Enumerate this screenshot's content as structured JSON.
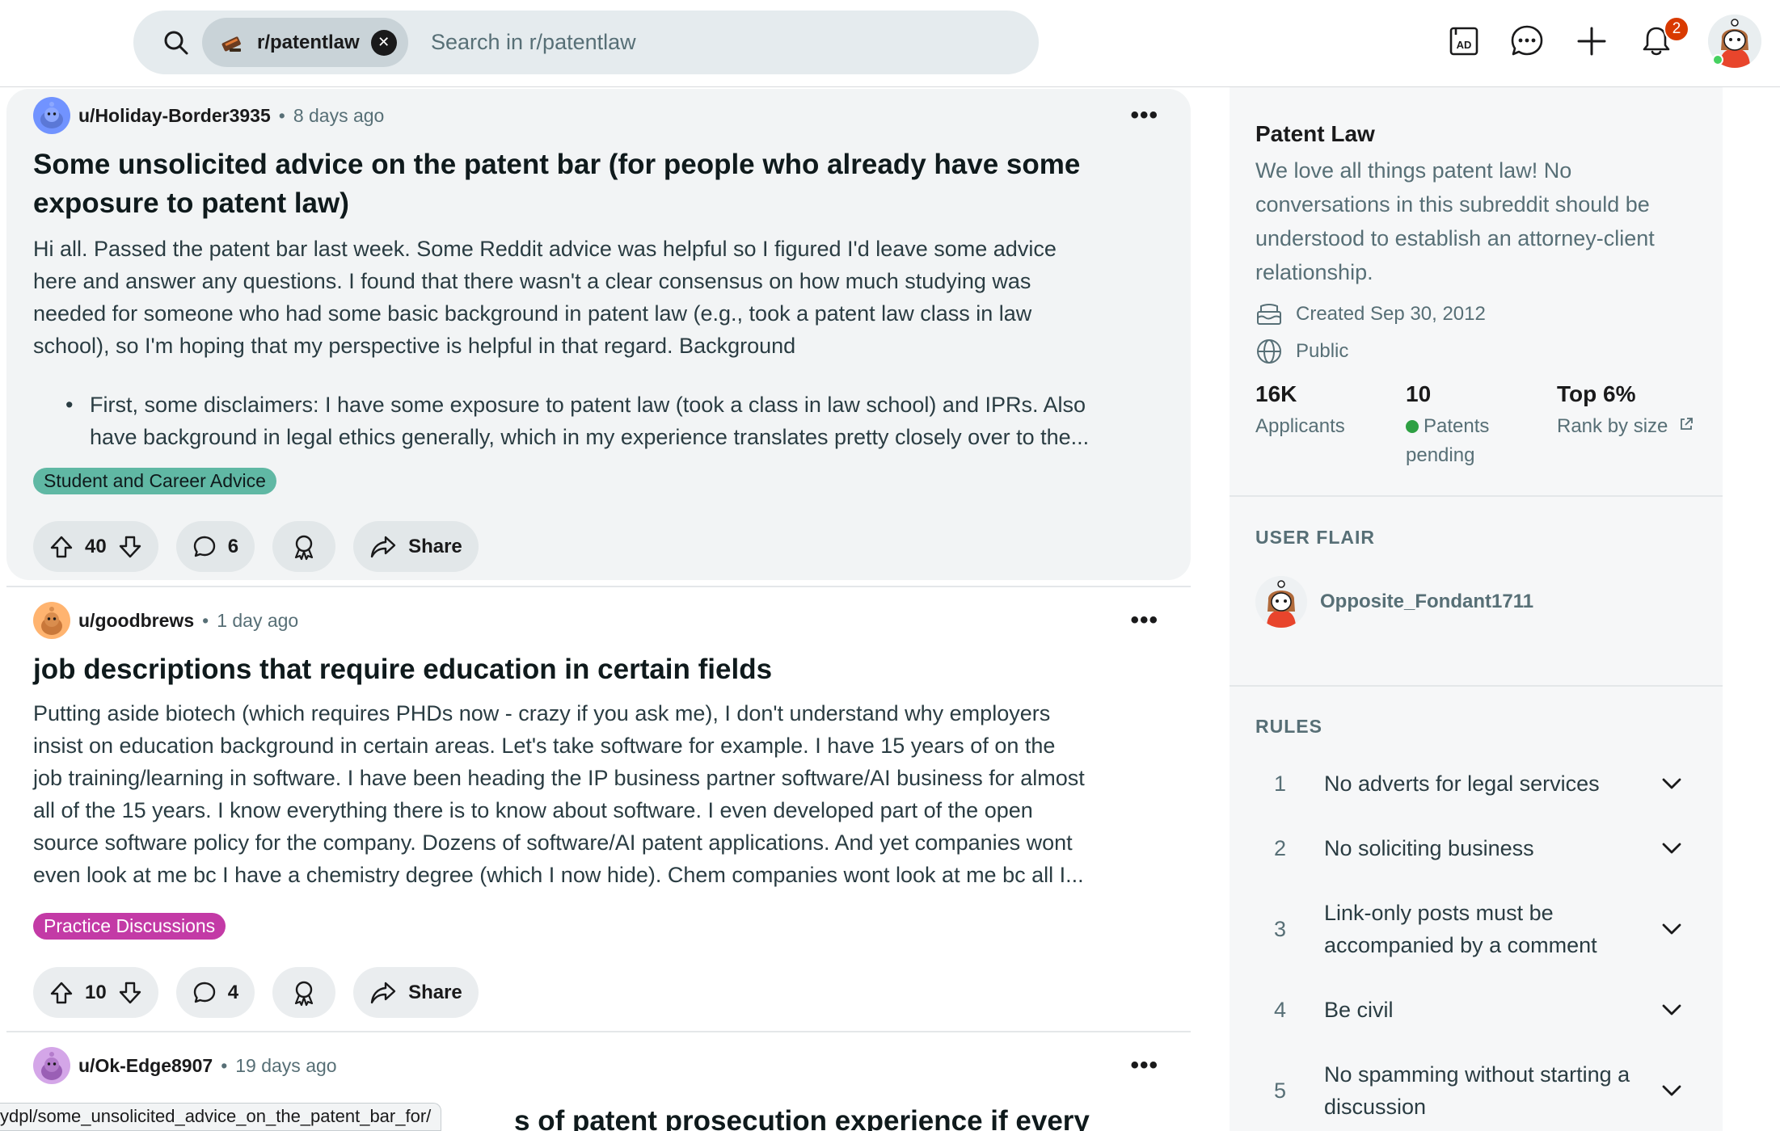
{
  "search": {
    "chip_label": "r/patentlaw",
    "placeholder": "Search in r/patentlaw"
  },
  "header": {
    "notification_count": "2",
    "icons": [
      "advertise-icon",
      "chat-icon",
      "create-post-icon",
      "notification-bell-icon",
      "user-avatar"
    ]
  },
  "posts": [
    {
      "author": "u/Holiday-Border3935",
      "separator": "•",
      "time": "8 days ago",
      "more": "•••",
      "title_line1": "Some unsolicited advice on the patent bar (for people who already have some",
      "title_line2": "exposure to patent law)",
      "body": [
        "Hi all. Passed the patent bar last week. Some Reddit advice was helpful so I figured I'd leave some advice",
        "here and answer any questions. I found that there wasn't a clear consensus on how much studying was",
        "needed for someone who had some basic background in patent law (e.g., took a patent law class in law",
        "school), so I'm hoping that my perspective is helpful in that regard. Background"
      ],
      "bullet": [
        "First, some disclaimers: I have some exposure to patent law (took a class in law school) and IPRs. Also",
        "have background in legal ethics generally, which in my experience translates pretty closely over to the..."
      ],
      "flair": "Student and Career Advice",
      "flair_bg": "#60b8a4",
      "votes": "40",
      "comments": "6",
      "share": "Share"
    },
    {
      "author": "u/goodbrews",
      "separator": "•",
      "time": "1 day ago",
      "more": "•••",
      "title_line1": "job descriptions that require education in certain fields",
      "body": [
        "Putting aside biotech (which requires PHDs now - crazy if you ask me), I don't understand why employers",
        "insist on education background in certain areas. Let's take software for example. I have 15 years of on the",
        "job training/learning in software. I have been heading the IP business partner software/AI business for almost",
        "all of the 15 years. I know everything there is to know about software. I even developed part of the open",
        "source software policy for the company. Dozens of software/AI patent applications. And yet companies wont",
        "even look at me bc I have a chemistry degree (which I now hide). Chem companies wont look at me bc all I..."
      ],
      "flair": "Practice Discussions",
      "flair_bg": "#c33aa6",
      "votes": "10",
      "comments": "4",
      "share": "Share"
    },
    {
      "author": "u/Ok-Edge8907",
      "separator": "•",
      "time": "19 days ago",
      "more": "•••",
      "title_partial": "s of patent prosecution experience if every"
    }
  ],
  "status_url": "ydpl/some_unsolicited_advice_on_the_patent_bar_for/",
  "sidebar": {
    "title": "Patent Law",
    "description": "We love all things patent law! No conversations in this subreddit should be understood to establish an attorney-client relationship.",
    "created": "Created Sep 30, 2012",
    "visibility": "Public",
    "stats": [
      {
        "value": "16K",
        "label": "Applicants"
      },
      {
        "value": "10",
        "label": "Patents pending"
      },
      {
        "value": "Top 6%",
        "label": "Rank by size"
      }
    ],
    "user_flair_heading": "USER FLAIR",
    "user_flair_name": "Opposite_Fondant1711",
    "rules_heading": "RULES",
    "rules": [
      {
        "num": "1",
        "text": "No adverts for legal services"
      },
      {
        "num": "2",
        "text": "No soliciting business"
      },
      {
        "num": "3",
        "text": "Link-only posts must be accompanied by a comment"
      },
      {
        "num": "4",
        "text": "Be civil"
      },
      {
        "num": "5",
        "text": "No spamming without starting a discussion"
      }
    ]
  }
}
